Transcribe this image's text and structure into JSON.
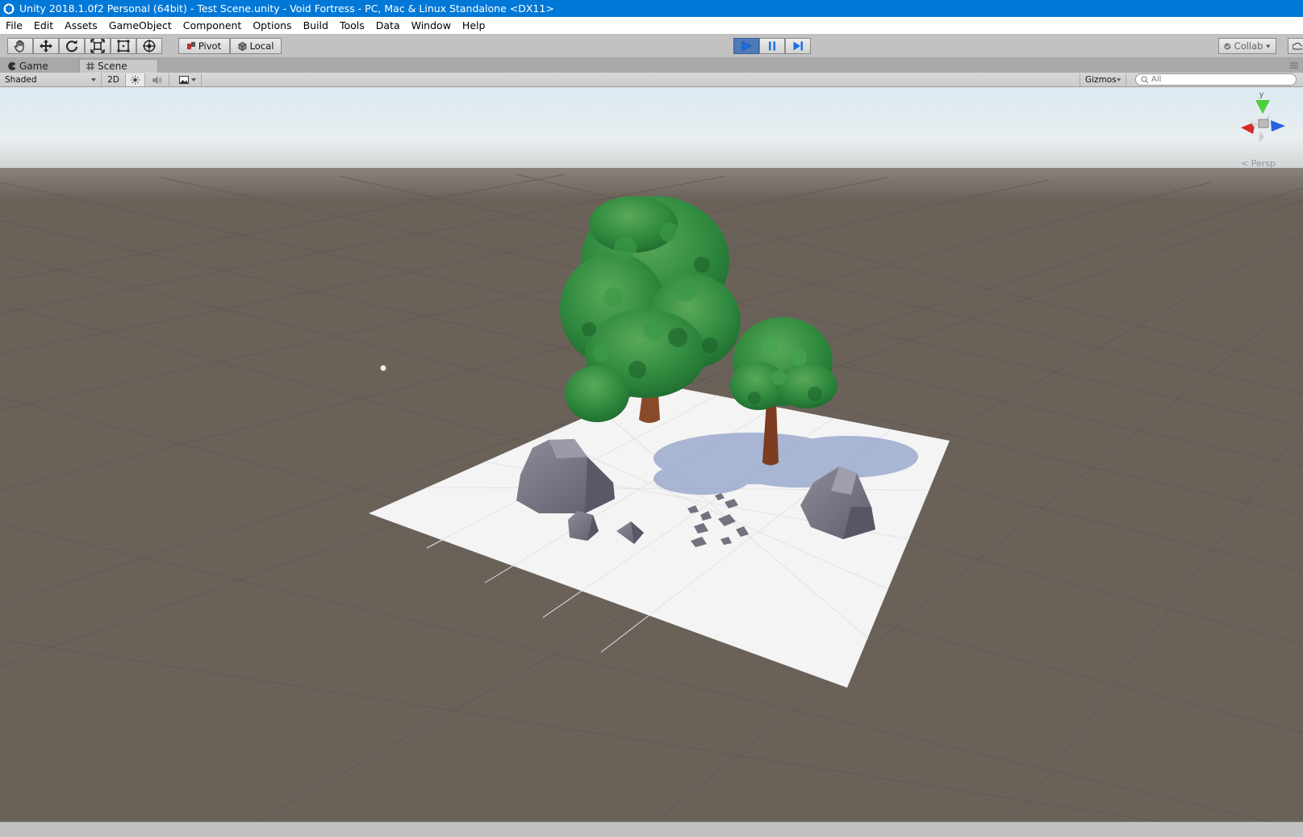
{
  "window": {
    "title": "Unity 2018.1.0f2 Personal (64bit) - Test Scene.unity - Void Fortress - PC, Mac & Linux Standalone <DX11>"
  },
  "menu": [
    "File",
    "Edit",
    "Assets",
    "GameObject",
    "Component",
    "Options",
    "Build",
    "Tools",
    "Data",
    "Window",
    "Help"
  ],
  "toolbar": {
    "tools": [
      "hand-tool-icon",
      "move-tool-icon",
      "rotate-tool-icon",
      "scale-tool-icon",
      "rect-tool-icon",
      "transform-tool-icon"
    ],
    "pivot_label": "Pivot",
    "local_label": "Local",
    "collab_label": "Collab"
  },
  "tabs": [
    {
      "label": "Game",
      "active": false
    },
    {
      "label": "Scene",
      "active": true
    }
  ],
  "scene_toolbar": {
    "draw_mode": "Shaded",
    "mode_2d": "2D",
    "gizmos_label": "Gizmos",
    "search_placeholder": "All"
  },
  "scene_gizmo": {
    "projection_label": "Persp",
    "axis_y": "y"
  },
  "colors": {
    "titlebar": "#0078d7",
    "play_active": "#4e7bb8",
    "ground": "#6a6259",
    "sky": "#dbe8f0"
  }
}
